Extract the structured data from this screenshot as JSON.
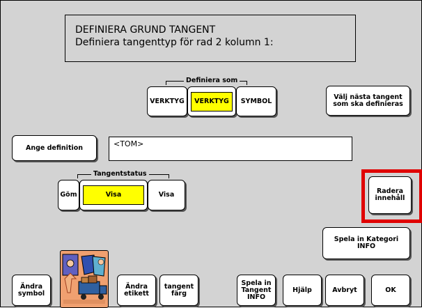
{
  "header": {
    "line1": "DEFINIERA GRUND TANGENT",
    "line2": "Definiera tangenttyp för rad 2 kolumn 1:"
  },
  "define_as": {
    "label": "Definiera som",
    "options": [
      "VERKTYG",
      "VERKTYG",
      "SYMBOL"
    ],
    "selected_index": 1
  },
  "next_key_button": {
    "line1": "Välj nästa tangent",
    "line2": "som ska definieras"
  },
  "definition": {
    "button": "Ange definition",
    "value": "<TOM>"
  },
  "status": {
    "label": "Tangentstatus",
    "options": [
      "Göm",
      "Visa",
      "Visa"
    ],
    "selected_index": 1
  },
  "clear_button": {
    "line1": "Radera",
    "line2": "innehåll"
  },
  "record_category_button": {
    "line1": "Spela in Kategori",
    "line2": "INFO"
  },
  "bottom": {
    "change_symbol": {
      "line1": "Ändra",
      "line2": "symbol"
    },
    "change_label": {
      "line1": "Ändra",
      "line2": "etikett"
    },
    "key_color": {
      "line1": "tangent",
      "line2": "färg"
    },
    "record_key_info": {
      "line1": "Spela in",
      "line2": "Tangent",
      "line3": "INFO"
    },
    "help": "Hjälp",
    "cancel": "Avbryt",
    "ok": "OK"
  },
  "colors": {
    "background": "#d3d3d3",
    "selected": "#ffff00",
    "highlight": "#e00000",
    "symbol_tile": "#f0a070"
  },
  "icons": {
    "symbol_tile": "people-truck-symbol-icon"
  }
}
